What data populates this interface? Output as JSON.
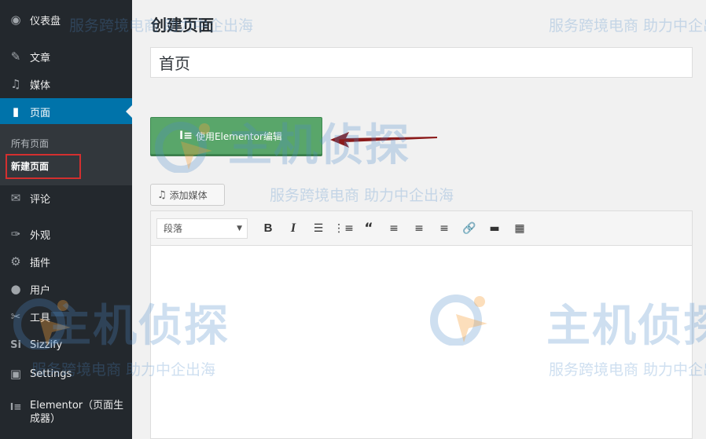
{
  "sidebar": {
    "items": [
      {
        "label": "仪表盘",
        "icon": "dashboard-icon",
        "glyph": "◉"
      },
      {
        "label": "文章",
        "icon": "pin-icon",
        "glyph": "✎"
      },
      {
        "label": "媒体",
        "icon": "media-icon",
        "glyph": "♫"
      },
      {
        "label": "页面",
        "icon": "page-icon",
        "glyph": "▮"
      },
      {
        "label": "评论",
        "icon": "comment-icon",
        "glyph": "✉"
      },
      {
        "label": "外观",
        "icon": "appearance-icon",
        "glyph": "✑"
      },
      {
        "label": "插件",
        "icon": "plugin-icon",
        "glyph": "⚙"
      },
      {
        "label": "用户",
        "icon": "user-icon",
        "glyph": "●"
      },
      {
        "label": "工具",
        "icon": "tool-icon",
        "glyph": "✂"
      },
      {
        "label": "Sizzify",
        "icon": "sizzify-icon",
        "glyph": "Si"
      },
      {
        "label": "Settings",
        "icon": "settings-icon",
        "glyph": "▣"
      },
      {
        "label": "Elementor（页面生成器）",
        "icon": "elementor-icon",
        "glyph": "I≡"
      }
    ],
    "submenu": {
      "all_pages": "所有页面",
      "new_page": "新建页面"
    }
  },
  "main": {
    "heading": "创建页面",
    "title_value": "首页",
    "elementor_button": "使用Elementor编辑",
    "add_media": "添加媒体",
    "toolbar": {
      "format_select": "段落",
      "buttons": [
        "bold",
        "italic",
        "bullet-list",
        "numbered-list",
        "blockquote",
        "align-left",
        "align-center",
        "align-right",
        "link",
        "read-more",
        "toolbar-toggle"
      ]
    }
  },
  "watermark": {
    "brand": "主机侦探",
    "slogan": "服务跨境电商 助力中企出海"
  },
  "colors": {
    "sidebar": "#23282d",
    "active": "#0073aa",
    "elementor_green": "#59a66a",
    "highlight_red": "#d32f2f",
    "arrow": "#8b1a1a"
  }
}
